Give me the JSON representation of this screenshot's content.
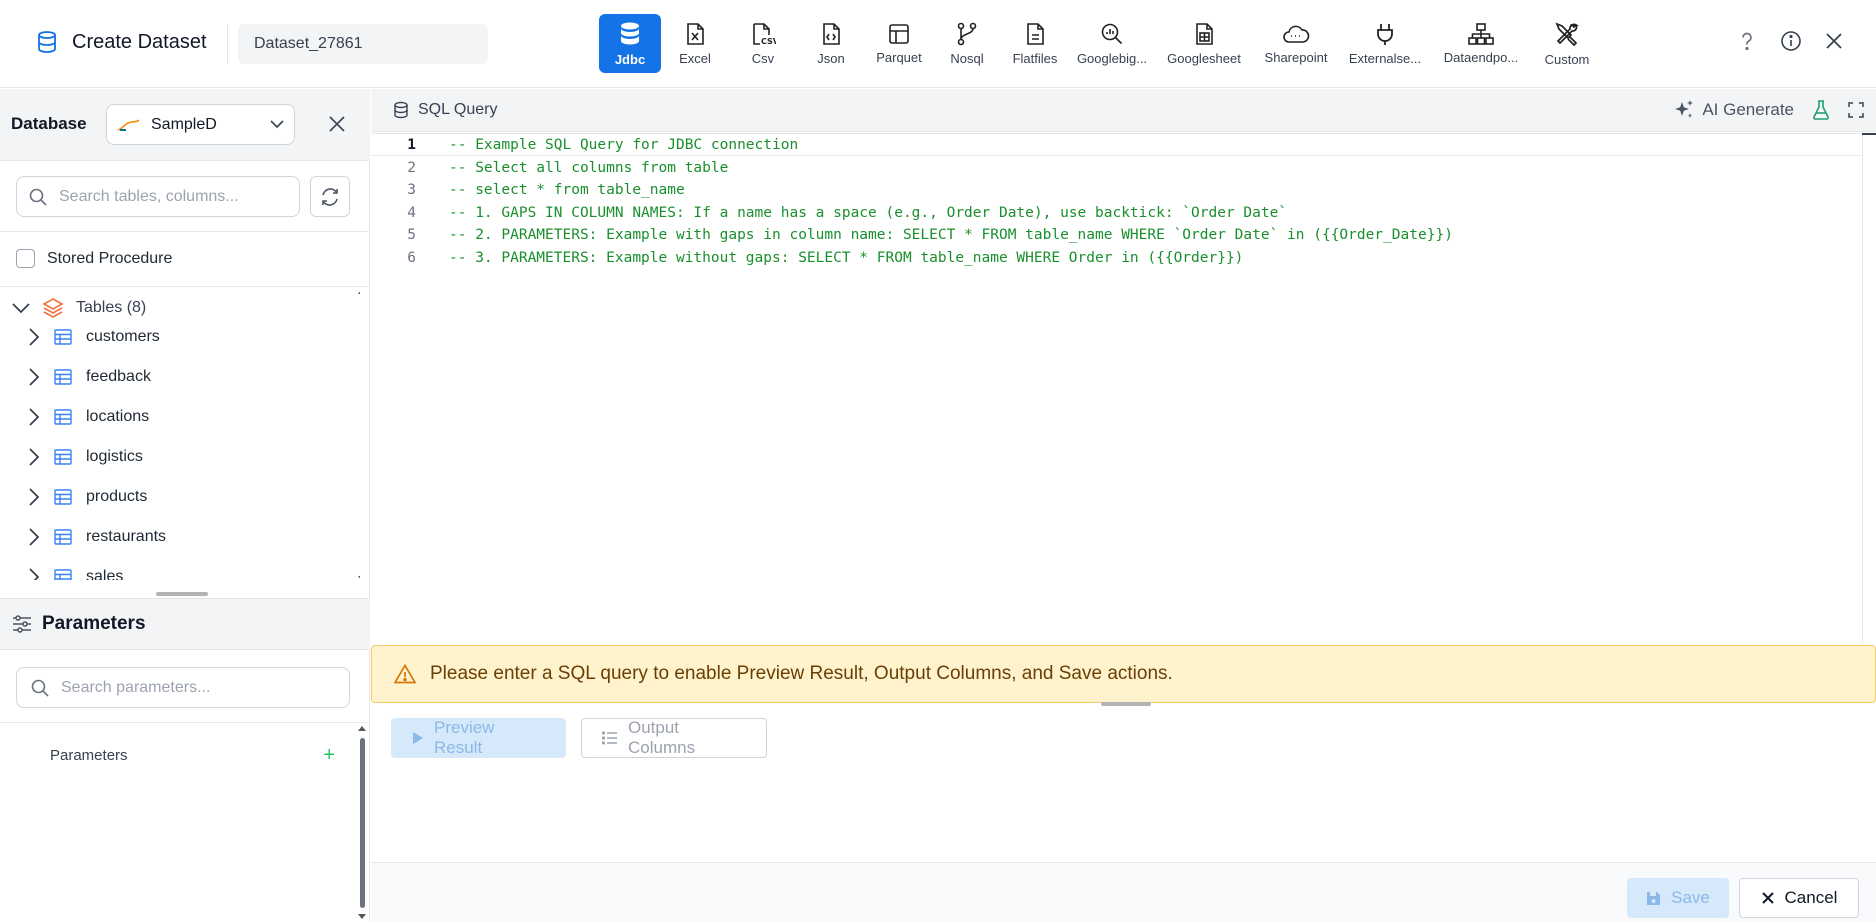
{
  "header": {
    "title": "Create Dataset",
    "dataset_name": "Dataset_27861",
    "source_tabs": [
      {
        "label": "Jdbc",
        "icon": "database-icon",
        "active": true
      },
      {
        "label": "Excel",
        "icon": "excel-file-icon"
      },
      {
        "label": "Csv",
        "icon": "csv-file-icon"
      },
      {
        "label": "Json",
        "icon": "json-file-icon"
      },
      {
        "label": "Parquet",
        "icon": "parquet-icon"
      },
      {
        "label": "Nosql",
        "icon": "nosql-branch-icon"
      },
      {
        "label": "Flatfiles",
        "icon": "flatfile-icon"
      },
      {
        "label": "Googlebig...",
        "icon": "bigquery-icon"
      },
      {
        "label": "Googlesheet",
        "icon": "googlesheet-icon"
      },
      {
        "label": "Sharepoint",
        "icon": "cloud-icon"
      },
      {
        "label": "Externalse...",
        "icon": "plug-icon"
      },
      {
        "label": "Dataendpo...",
        "icon": "network-icon"
      },
      {
        "label": "Custom",
        "icon": "tools-icon"
      }
    ]
  },
  "sidebar": {
    "database_label": "Database",
    "database_value": "SampleD",
    "search_placeholder": "Search tables, columns...",
    "stored_procedure_label": "Stored Procedure",
    "tables_root_label": "Tables (8)",
    "tables": [
      "customers",
      "feedback",
      "locations",
      "logistics",
      "products",
      "restaurants",
      "sales"
    ],
    "parameters_header": "Parameters",
    "parameters_search_placeholder": "Search parameters...",
    "parameters_label": "Parameters",
    "add_symbol": "+"
  },
  "editor": {
    "tab_label": "SQL Query",
    "ai_generate_label": "AI Generate",
    "lines": [
      "-- Example SQL Query for JDBC connection",
      "-- Select all columns from table",
      "-- select * from table_name",
      "-- 1. GAPS IN COLUMN NAMES: If a name has a space (e.g., Order Date), use backtick: `Order Date`",
      "-- 2. PARAMETERS: Example with gaps in column name: SELECT * FROM table_name WHERE `Order Date` in ({{Order_Date}})",
      "-- 3. PARAMETERS: Example without gaps: SELECT * FROM table_name WHERE Order in ({{Order}})"
    ],
    "line_numbers": [
      "1",
      "2",
      "3",
      "4",
      "5",
      "6"
    ]
  },
  "warning": {
    "text": "Please enter a SQL query to enable Preview Result, Output Columns, and Save actions."
  },
  "actions": {
    "preview_label": "Preview Result",
    "output_columns_label": "Output Columns",
    "save_label": "Save",
    "cancel_label": "Cancel"
  },
  "colors": {
    "accent": "#1473e6",
    "comment_green": "#1a8f2e",
    "warning_bg": "#fff3cd",
    "warning_text": "#6b3e04"
  }
}
